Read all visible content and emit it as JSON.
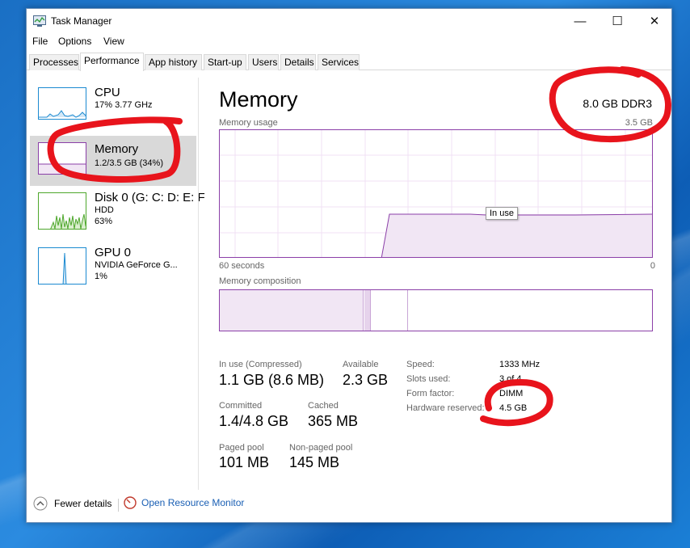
{
  "window": {
    "title": "Task Manager",
    "controls": {
      "minimize": "—",
      "maximize": "☐",
      "close": "✕"
    }
  },
  "menu": [
    "File",
    "Options",
    "View"
  ],
  "tabs": [
    "Processes",
    "Performance",
    "App history",
    "Start-up",
    "Users",
    "Details",
    "Services"
  ],
  "active_tab": "Performance",
  "sidebar": {
    "items": [
      {
        "name": "CPU",
        "sub1": "17% 3.77 GHz",
        "sub2": "",
        "color": "#1b8ad1"
      },
      {
        "name": "Memory",
        "sub1": "1.2/3.5 GB (34%)",
        "sub2": "",
        "color": "#8b3fa8"
      },
      {
        "name": "Disk 0 (G: C: D: E: F",
        "sub1": "HDD",
        "sub2": "63%",
        "color": "#4ea72c"
      },
      {
        "name": "GPU 0",
        "sub1": "NVIDIA GeForce G...",
        "sub2": "1%",
        "color": "#1b8ad1"
      }
    ]
  },
  "main": {
    "title": "Memory",
    "spec": "8.0 GB DDR3",
    "usage_label": "Memory usage",
    "usage_max": "3.5 GB",
    "time_left": "60 seconds",
    "time_right": "0",
    "tooltip": "In use",
    "composition_label": "Memory composition",
    "usage_level": 0.34
  },
  "stats": {
    "in_use_label": "In use (Compressed)",
    "in_use_value": "1.1 GB (8.6 MB)",
    "available_label": "Available",
    "available_value": "2.3 GB",
    "committed_label": "Committed",
    "committed_value": "1.4/4.8 GB",
    "cached_label": "Cached",
    "cached_value": "365 MB",
    "paged_label": "Paged pool",
    "paged_value": "101 MB",
    "nonpaged_label": "Non-paged pool",
    "nonpaged_value": "145 MB"
  },
  "details": [
    {
      "key": "Speed:",
      "value": "1333 MHz"
    },
    {
      "key": "Slots used:",
      "value": "3 of 4"
    },
    {
      "key": "Form factor:",
      "value": "DIMM"
    },
    {
      "key": "Hardware reserved:",
      "value": "4.5 GB"
    }
  ],
  "footer": {
    "fewer_details": "Fewer details",
    "resource_monitor": "Open Resource Monitor"
  },
  "annotation_color": "#e8141c",
  "icons": [
    "task-manager-icon",
    "chevron-up-icon",
    "resource-monitor-icon"
  ]
}
